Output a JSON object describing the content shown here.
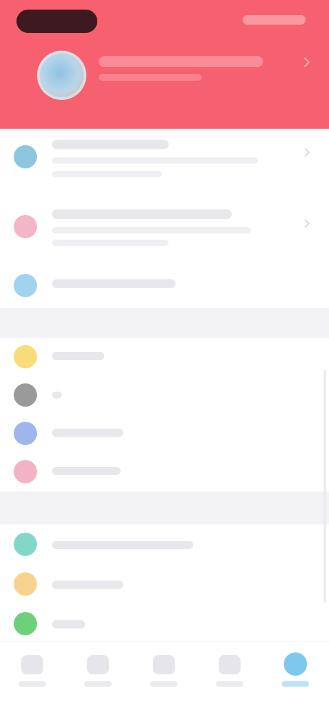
{
  "header": {
    "accent_color": "#f7606e",
    "avatar_icon": "user-avatar-icon"
  },
  "sections": [
    {
      "items": [
        {
          "icon": "wallet-icon",
          "icon_color": "#8cc7df"
        },
        {
          "icon": "heart-icon",
          "icon_color": "#f3b6c6"
        },
        {
          "icon": "chat-icon",
          "icon_color": "#9fd3ee"
        }
      ]
    },
    {
      "items": [
        {
          "icon": "star-icon",
          "icon_color": "#f8dc7a"
        },
        {
          "icon": "gear-icon",
          "icon_color": "#9a9a9a"
        },
        {
          "icon": "shield-icon",
          "icon_color": "#9fb6ec"
        },
        {
          "icon": "bell-icon",
          "icon_color": "#f2b3c3"
        }
      ]
    },
    {
      "items": [
        {
          "icon": "help-icon",
          "icon_color": "#83d7c9"
        },
        {
          "icon": "info-icon",
          "icon_color": "#f8d38e"
        },
        {
          "icon": "share-icon",
          "icon_color": "#6fd07a"
        }
      ]
    }
  ],
  "tabbar": {
    "tabs": [
      {
        "icon": "home-icon"
      },
      {
        "icon": "discover-icon"
      },
      {
        "icon": "add-icon"
      },
      {
        "icon": "message-icon"
      },
      {
        "icon": "profile-icon",
        "active": true
      }
    ],
    "active_color": "#7cc8ef"
  }
}
